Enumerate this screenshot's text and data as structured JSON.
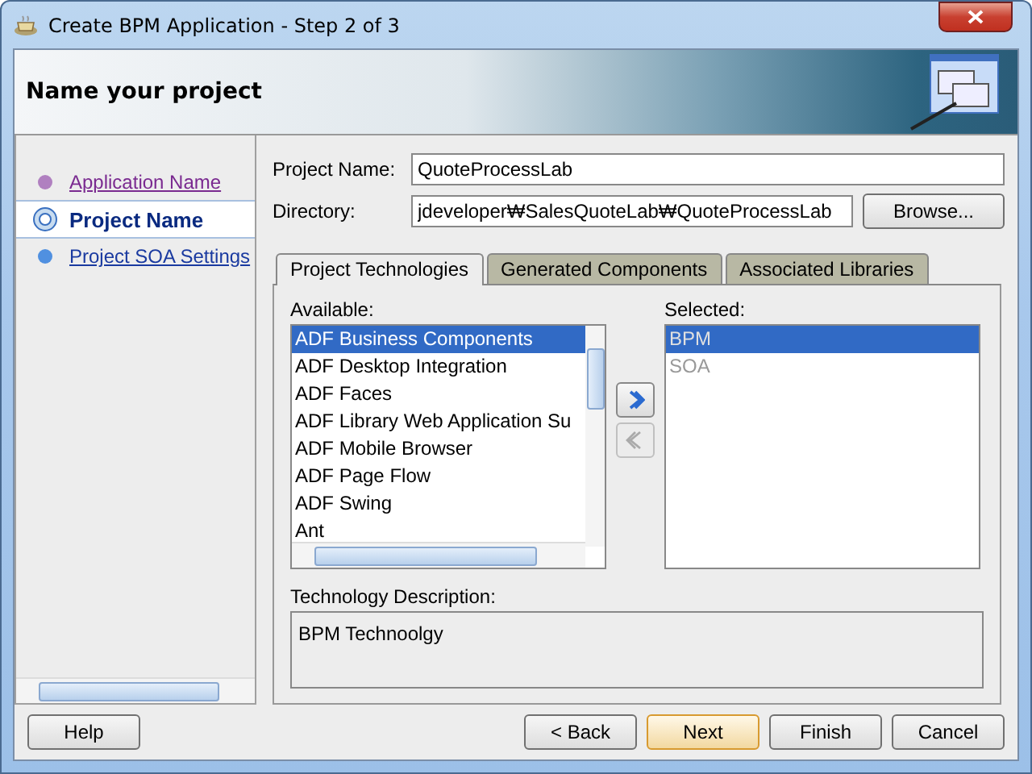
{
  "window": {
    "title": "Create BPM Application - Step 2 of 3"
  },
  "header": {
    "title": "Name your project"
  },
  "steps": [
    {
      "label": "Application Name",
      "kind": "visited",
      "selected": false
    },
    {
      "label": "Project Name",
      "kind": "current",
      "selected": true
    },
    {
      "label": "Project SOA Settings",
      "kind": "pending",
      "selected": false
    }
  ],
  "form": {
    "project_name": {
      "label": "Project Name:",
      "value": "QuoteProcessLab"
    },
    "directory": {
      "label": "Directory:",
      "value": "jdeveloper₩SalesQuoteLab₩QuoteProcessLab"
    },
    "browse_button": "Browse..."
  },
  "tabs": [
    {
      "label": "Project Technologies",
      "selected": true
    },
    {
      "label": "Generated Components",
      "selected": false
    },
    {
      "label": "Associated Libraries",
      "selected": false
    }
  ],
  "available": {
    "label": "Available:",
    "items": [
      {
        "text": "ADF Business Components",
        "selected": true
      },
      {
        "text": "ADF Desktop Integration",
        "selected": false
      },
      {
        "text": "ADF Faces",
        "selected": false
      },
      {
        "text": "ADF Library Web Application Su",
        "selected": false
      },
      {
        "text": "ADF Mobile Browser",
        "selected": false
      },
      {
        "text": "ADF Page Flow",
        "selected": false
      },
      {
        "text": "ADF Swing",
        "selected": false
      },
      {
        "text": "Ant",
        "selected": false
      }
    ]
  },
  "move_buttons": [
    {
      "kind": "add",
      "disabled": false
    },
    {
      "kind": "remove",
      "disabled": true
    }
  ],
  "selected_list": {
    "label": "Selected:",
    "items": [
      {
        "text": "BPM",
        "selected": true,
        "disabled": true
      },
      {
        "text": "SOA",
        "selected": false,
        "disabled": true
      }
    ]
  },
  "description": {
    "label": "Technology Description:",
    "text": "BPM Technoolgy"
  },
  "buttons": [
    {
      "label": "Help",
      "default": false
    },
    {
      "label": "< Back",
      "default": false
    },
    {
      "label": "Next",
      "default": true
    },
    {
      "label": "Finish",
      "default": false
    },
    {
      "label": "Cancel",
      "default": false
    }
  ]
}
